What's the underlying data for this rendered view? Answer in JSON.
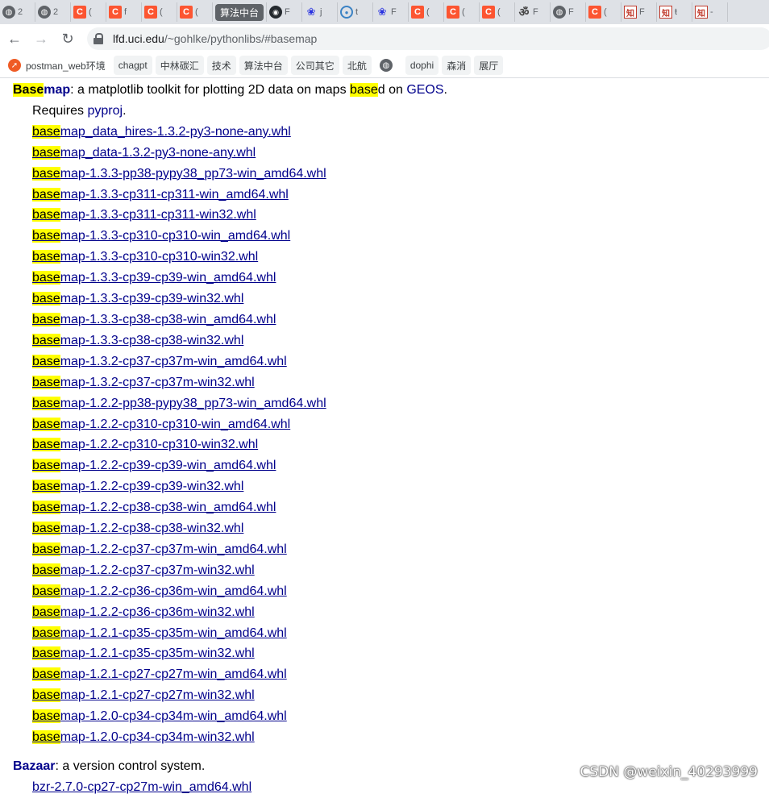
{
  "tabs": [
    {
      "icon": "globe-icon",
      "letter": "2"
    },
    {
      "icon": "globe-icon",
      "letter": "2"
    },
    {
      "icon": "csdn-icon",
      "letter": "("
    },
    {
      "icon": "csdn-icon",
      "letter": "f"
    },
    {
      "icon": "csdn-icon",
      "letter": "("
    },
    {
      "icon": "csdn-icon",
      "letter": "("
    },
    {
      "icon": "pill",
      "letter": "算法中台"
    },
    {
      "icon": "github-icon",
      "letter": "F"
    },
    {
      "icon": "baidu-icon",
      "letter": "j"
    },
    {
      "icon": "circle-icon",
      "letter": "t"
    },
    {
      "icon": "baidu-icon",
      "letter": "F"
    },
    {
      "icon": "csdn-icon",
      "letter": "("
    },
    {
      "icon": "csdn-icon",
      "letter": "("
    },
    {
      "icon": "csdn-icon",
      "letter": "("
    },
    {
      "icon": "om-icon",
      "letter": "F"
    },
    {
      "icon": "globe-icon",
      "letter": "F"
    },
    {
      "icon": "csdn-icon",
      "letter": "("
    },
    {
      "icon": "zhihu-icon",
      "letter": "F"
    },
    {
      "icon": "zhihu-icon",
      "letter": "ŧ"
    },
    {
      "icon": "zhihu-icon",
      "letter": "-"
    }
  ],
  "toolbar": {
    "back": "←",
    "forward": "→",
    "reload": "↻",
    "url_host": "lfd.uci.edu",
    "url_rest": "/~gohlke/pythonlibs/#basemap"
  },
  "bookmarks": [
    {
      "label": "postman_web环境",
      "icon": "orange"
    },
    {
      "label": "chagpt"
    },
    {
      "label": "中林碳汇"
    },
    {
      "label": "技术"
    },
    {
      "label": "算法中台"
    },
    {
      "label": "公司其它"
    },
    {
      "label": "北航"
    },
    {
      "label": "",
      "icon": "globe"
    },
    {
      "label": "dophi"
    },
    {
      "label": "森消"
    },
    {
      "label": "展厅"
    }
  ],
  "basemap": {
    "name_hl": "Base",
    "name_rest": "map",
    "desc_1": ": a matplotlib toolkit for plotting 2D data on maps ",
    "desc_hl": "base",
    "desc_2": "d on ",
    "geos": "GEOS",
    "desc_end": ".",
    "requires": "Requires ",
    "pyproj": "pyproj",
    "requires_end": ".",
    "hl": "base",
    "files": [
      "map_data_hires-1.3.2-py3-none-any.whl",
      "map_data-1.3.2-py3-none-any.whl",
      "map-1.3.3-pp38-pypy38_pp73-win_amd64.whl",
      "map-1.3.3-cp311-cp311-win_amd64.whl",
      "map-1.3.3-cp311-cp311-win32.whl",
      "map-1.3.3-cp310-cp310-win_amd64.whl",
      "map-1.3.3-cp310-cp310-win32.whl",
      "map-1.3.3-cp39-cp39-win_amd64.whl",
      "map-1.3.3-cp39-cp39-win32.whl",
      "map-1.3.3-cp38-cp38-win_amd64.whl",
      "map-1.3.3-cp38-cp38-win32.whl",
      "map-1.3.2-cp37-cp37m-win_amd64.whl",
      "map-1.3.2-cp37-cp37m-win32.whl",
      "map-1.2.2-pp38-pypy38_pp73-win_amd64.whl",
      "map-1.2.2-cp310-cp310-win_amd64.whl",
      "map-1.2.2-cp310-cp310-win32.whl",
      "map-1.2.2-cp39-cp39-win_amd64.whl",
      "map-1.2.2-cp39-cp39-win32.whl",
      "map-1.2.2-cp38-cp38-win_amd64.whl",
      "map-1.2.2-cp38-cp38-win32.whl",
      "map-1.2.2-cp37-cp37m-win_amd64.whl",
      "map-1.2.2-cp37-cp37m-win32.whl",
      "map-1.2.2-cp36-cp36m-win_amd64.whl",
      "map-1.2.2-cp36-cp36m-win32.whl",
      "map-1.2.1-cp35-cp35m-win_amd64.whl",
      "map-1.2.1-cp35-cp35m-win32.whl",
      "map-1.2.1-cp27-cp27m-win_amd64.whl",
      "map-1.2.1-cp27-cp27m-win32.whl",
      "map-1.2.0-cp34-cp34m-win_amd64.whl",
      "map-1.2.0-cp34-cp34m-win32.whl"
    ]
  },
  "bazaar": {
    "name": "Bazaar",
    "desc": ": a version control system.",
    "files": [
      "bzr-2.7.0-cp27-cp27m-win_amd64.whl"
    ]
  },
  "watermark": "CSDN @weixin_40293999"
}
